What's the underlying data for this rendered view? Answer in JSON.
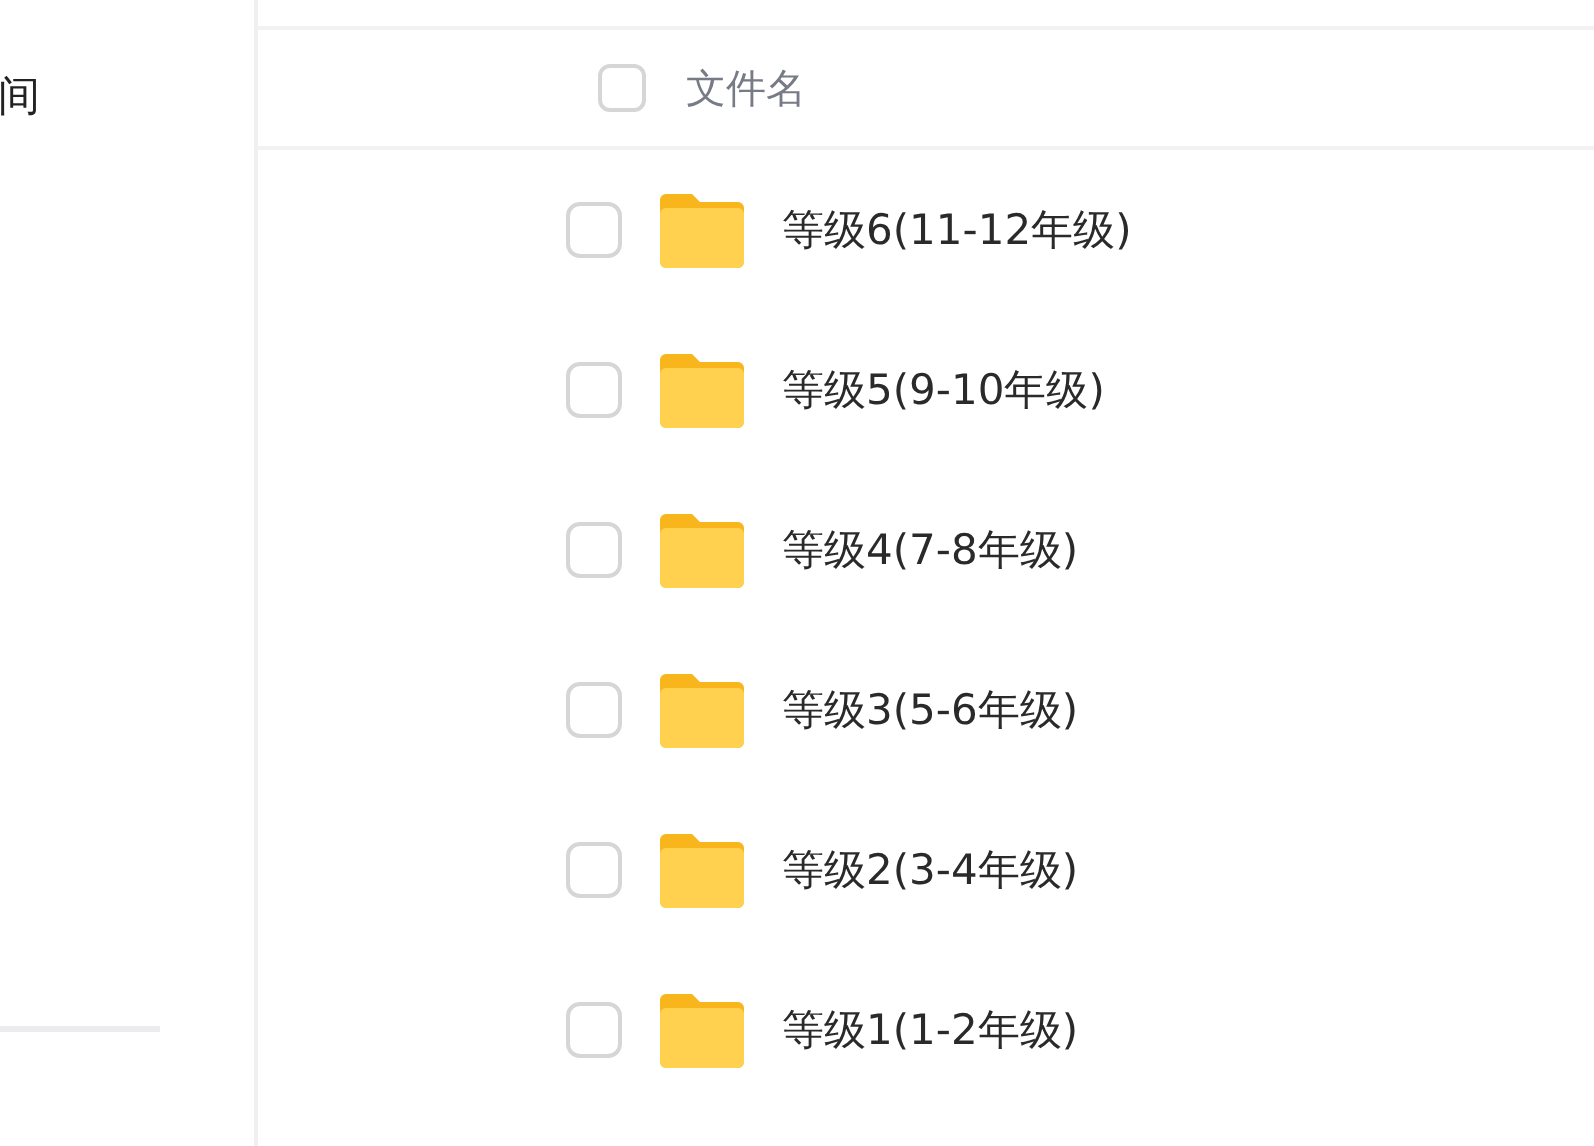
{
  "sidebar": {
    "items": [
      {
        "label": "间"
      }
    ]
  },
  "file_list": {
    "header": {
      "label": "文件名",
      "checked": false
    },
    "rows": [
      {
        "name": "等级6(11-12年级)",
        "checked": false
      },
      {
        "name": "等级5(9-10年级)",
        "checked": false
      },
      {
        "name": "等级4(7-8年级)",
        "checked": false
      },
      {
        "name": "等级3(5-6年级)",
        "checked": false
      },
      {
        "name": "等级2(3-4年级)",
        "checked": false
      },
      {
        "name": "等级1(1-2年级)",
        "checked": false
      }
    ]
  }
}
